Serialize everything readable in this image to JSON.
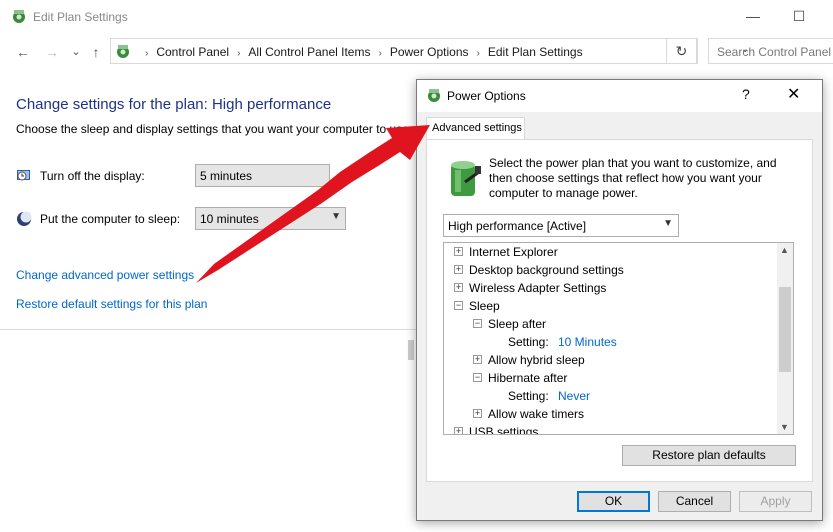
{
  "window": {
    "title": "Edit Plan Settings",
    "controls": {
      "minimize": "—",
      "maximize": "☐"
    }
  },
  "nav": {
    "back": "←",
    "forward": "→",
    "recent": "⌄",
    "up": "↑"
  },
  "address": {
    "crumbs": [
      "Control Panel",
      "All Control Panel Items",
      "Power Options",
      "Edit Plan Settings"
    ],
    "separator": "›",
    "dropdown": "⌄",
    "refresh": "↻"
  },
  "search": {
    "placeholder": "Search Control Panel"
  },
  "content": {
    "title": "Change settings for the plan: High performance",
    "subtitle": "Choose the sleep and display settings that you want your computer to use.",
    "display": {
      "label": "Turn off the display:",
      "value": "5 minutes"
    },
    "sleep": {
      "label": "Put the computer to sleep:",
      "value": "10 minutes"
    },
    "links": {
      "advanced": "Change advanced power settings",
      "restore": "Restore default settings for this plan"
    }
  },
  "dialog": {
    "title": "Power Options",
    "help": "?",
    "close": "✕",
    "tab": "Advanced settings",
    "intro": "Select the power plan that you want to customize, and then choose settings that reflect how you want your computer to manage power.",
    "plan": "High performance [Active]",
    "tree": [
      {
        "text": "Internet Explorer",
        "toggle": "+",
        "level": 0
      },
      {
        "text": "Desktop background settings",
        "toggle": "+",
        "level": 0
      },
      {
        "text": "Wireless Adapter Settings",
        "toggle": "+",
        "level": 0
      },
      {
        "text": "Sleep",
        "toggle": "−",
        "level": 0
      },
      {
        "text": "Sleep after",
        "toggle": "−",
        "level": 1
      },
      {
        "text": "Setting:",
        "value": "10 Minutes",
        "level": 2
      },
      {
        "text": "Allow hybrid sleep",
        "toggle": "+",
        "level": 1
      },
      {
        "text": "Hibernate after",
        "toggle": "−",
        "level": 1
      },
      {
        "text": "Setting:",
        "value": "Never",
        "level": 2
      },
      {
        "text": "Allow wake timers",
        "toggle": "+",
        "level": 1
      },
      {
        "text": "USB settings",
        "toggle": "+",
        "level": 0
      }
    ],
    "buttons": {
      "restore": "Restore plan defaults",
      "ok": "OK",
      "cancel": "Cancel",
      "apply": "Apply"
    }
  },
  "colors": {
    "link": "#0066cc",
    "heading": "#1e3287",
    "arrow": "#e0141e"
  }
}
